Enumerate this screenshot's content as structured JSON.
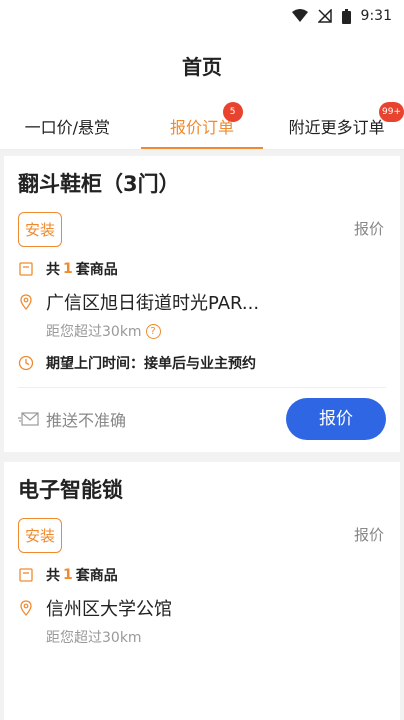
{
  "status_bar": {
    "time": "9:31"
  },
  "header": {
    "title": "首页"
  },
  "tabs": [
    {
      "label": "一口价/悬赏"
    },
    {
      "label": "报价订单",
      "badge": "5"
    },
    {
      "label": "附近更多订单",
      "badge": "99+"
    }
  ],
  "orders": [
    {
      "title": "翻斗鞋柜（3门）",
      "tag": "安装",
      "quote_label": "报价",
      "goods_prefix": "共",
      "goods_count": "1",
      "goods_suffix": "套商品",
      "address": "广信区旭日街道时光PAR...",
      "distance": "距您超过30km",
      "expected_time": "期望上门时间：接单后与业主预约",
      "push_inaccurate": "推送不准确",
      "quote_button": "报价"
    },
    {
      "title": "电子智能锁",
      "tag": "安装",
      "quote_label": "报价",
      "goods_prefix": "共",
      "goods_count": "1",
      "goods_suffix": "套商品",
      "address": "信州区大学公馆",
      "distance": "距您超过30km"
    }
  ],
  "colors": {
    "accent": "#f08a2e",
    "primary": "#2e66e3",
    "badge": "#e8432e"
  }
}
